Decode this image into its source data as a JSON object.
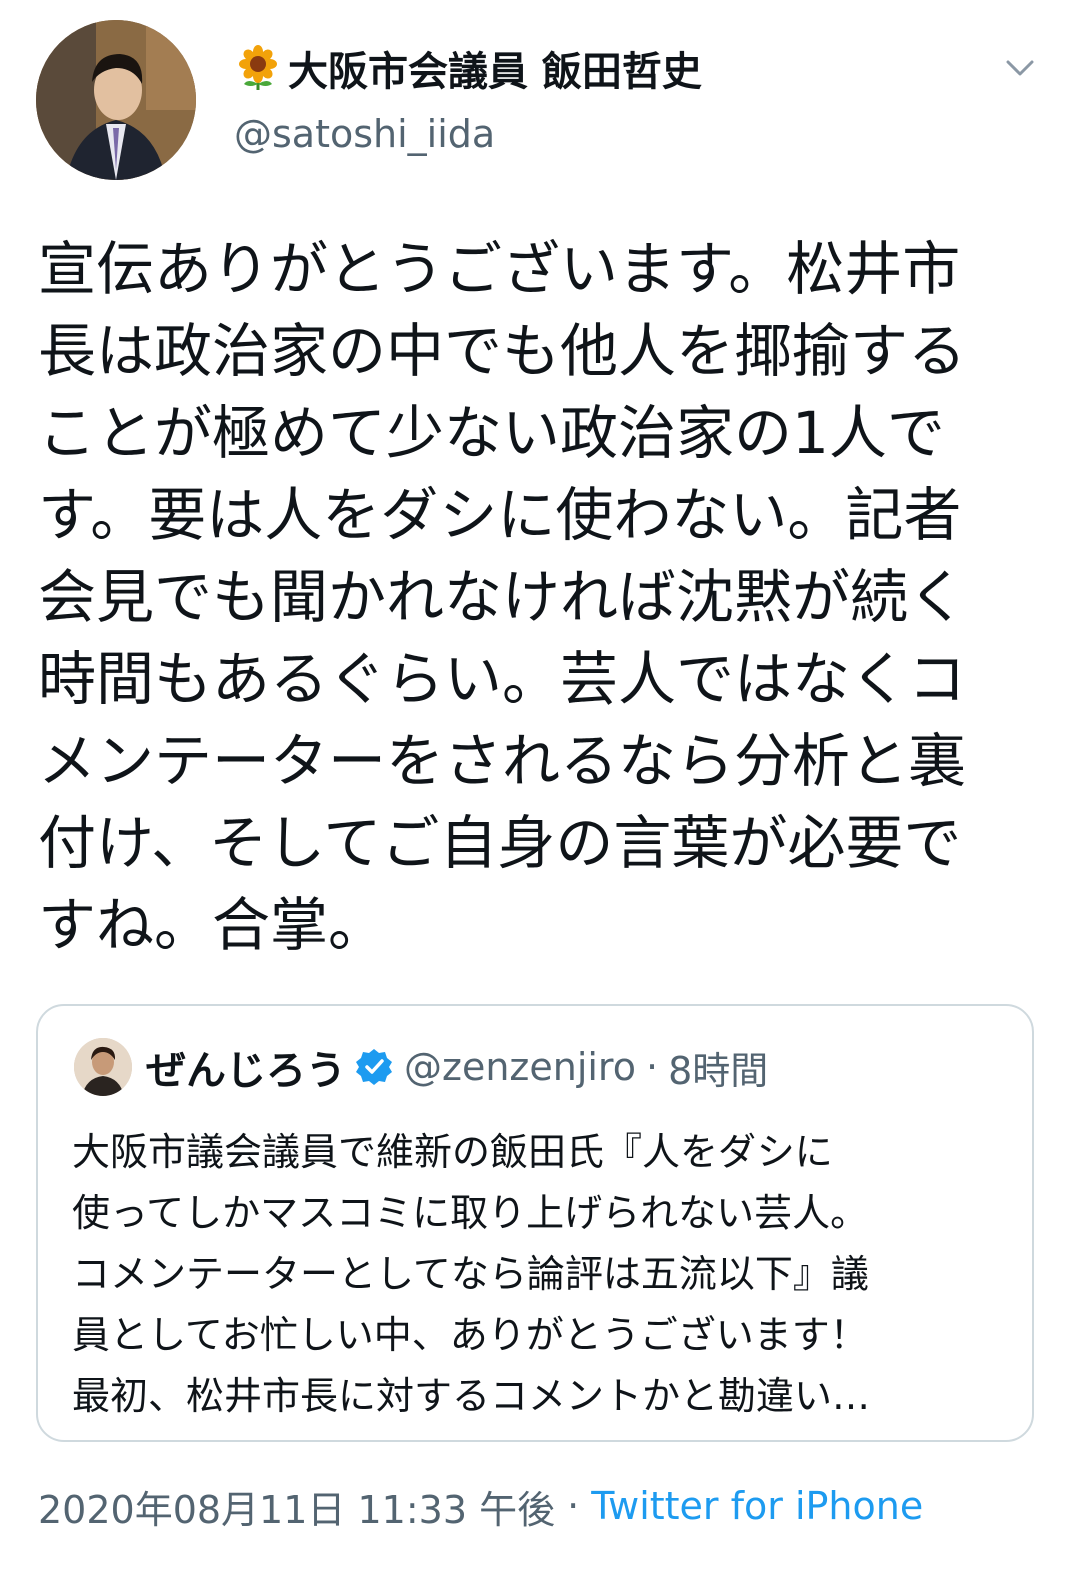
{
  "author": {
    "display_name": "大阪市会議員 飯田哲史",
    "handle": "@satoshi_iida",
    "avatar": "profile-photo",
    "name_prefix_icon": "sunflower-icon"
  },
  "tweet": {
    "text_lines": [
      "宣伝ありがとうございます。松井市",
      "長は政治家の中でも他人を揶揄する",
      "ことが極めて少ない政治家の1人で",
      "す。要は人をダシに使わない。記者",
      "会見でも聞かれなければ沈黙が続く",
      "時間もあるぐらい。芸人ではなくコ",
      "メンテーターをされるなら分析と裏",
      "付け、そしてご自身の言葉が必要で",
      "すね。合掌。"
    ]
  },
  "quote": {
    "name": "ぜんじろう",
    "verified_icon": "verified-badge-icon",
    "handle": "@zenzenjiro",
    "separator": "·",
    "time": "8時間",
    "text_lines": [
      "大阪市議会議員で維新の飯田氏『人をダシに",
      "使ってしかマスコミに取り上げられない芸人。",
      "コメンテーターとしてなら論評は五流以下』議",
      "員としてお忙しい中、ありがとうございます！",
      "最初、松井市長に対するコメントかと勘違い…"
    ]
  },
  "footer": {
    "timestamp": "2020年08月11日 11:33 午後",
    "separator": "·",
    "source": "Twitter for iPhone"
  },
  "colors": {
    "text": "#0f1419",
    "secondary": "#536471",
    "link": "#1d9bf0",
    "border": "#cfd9de"
  }
}
